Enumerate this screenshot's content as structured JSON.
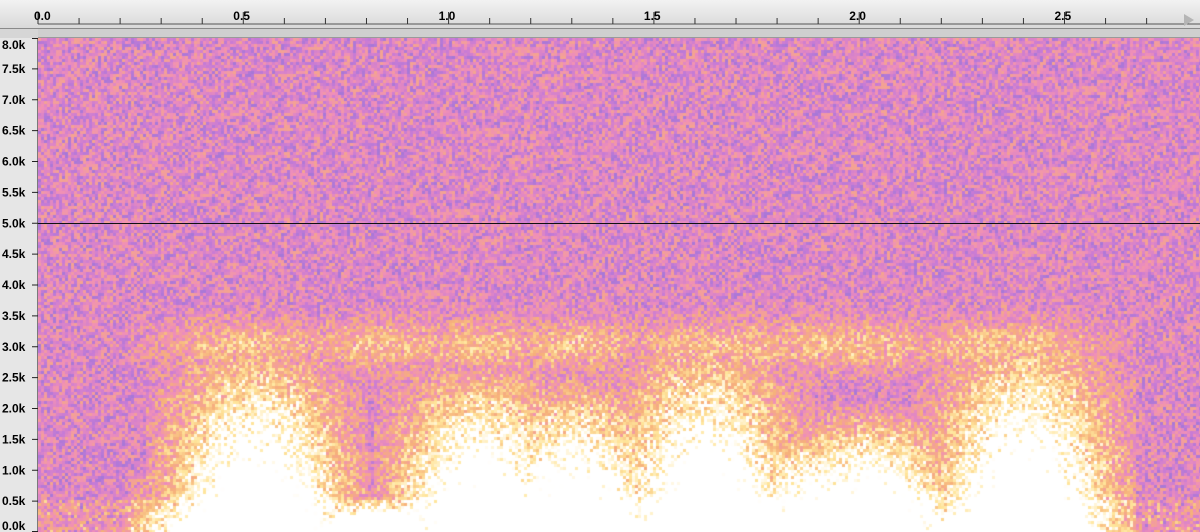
{
  "time_ruler": {
    "unit": "seconds",
    "labels": [
      "0.0",
      "0.5",
      "1.0",
      "1.5",
      "2.0",
      "2.5"
    ],
    "values": [
      0.0,
      0.5,
      1.0,
      1.5,
      2.0,
      2.5
    ],
    "minor_step": 0.1
  },
  "frequency_axis": {
    "labels": [
      "8.0k",
      "7.5k",
      "7.0k",
      "6.5k",
      "6.0k",
      "5.5k",
      "5.0k",
      "4.5k",
      "4.0k",
      "3.5k",
      "3.0k",
      "2.5k",
      "2.0k",
      "1.5k",
      "1.0k",
      "0.5k",
      "0.0k"
    ],
    "values": [
      8000,
      7500,
      7000,
      6500,
      6000,
      5500,
      5000,
      4500,
      4000,
      3500,
      3000,
      2500,
      2000,
      1500,
      1000,
      500,
      0
    ],
    "range_hz": [
      0,
      8000
    ],
    "range_s": [
      0,
      2.83
    ]
  },
  "spectrogram": {
    "palette": [
      "#7f73d9",
      "#c77bd6",
      "#f08fb8",
      "#f6b07a",
      "#ffe59a",
      "#ffffff"
    ],
    "divider_hz": 5000,
    "bursts_s": [
      0.48,
      0.53,
      0.83,
      1.08,
      1.3,
      1.62,
      1.72,
      1.92,
      2.02,
      2.3,
      2.4
    ]
  },
  "icons": {
    "play_head": "play-head-triangle-icon"
  }
}
